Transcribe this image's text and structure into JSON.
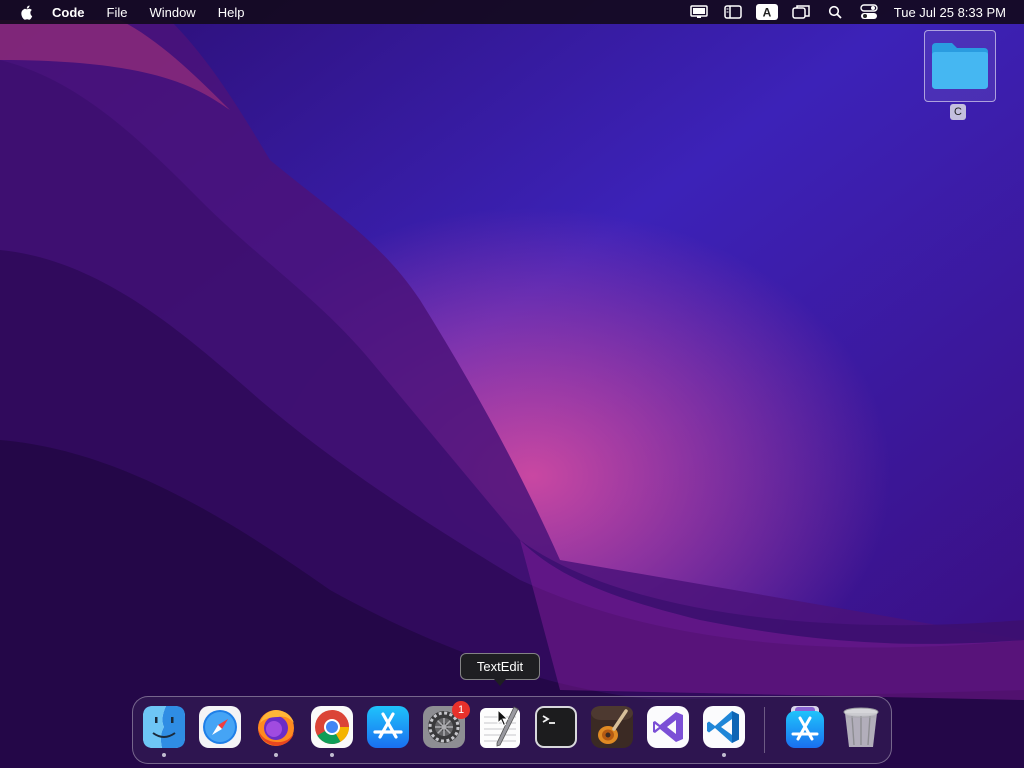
{
  "menubar": {
    "app_name": "Code",
    "items": [
      "File",
      "Window",
      "Help"
    ],
    "status_icons": [
      "display-icon",
      "sidebar-icon",
      "input-source-icon",
      "screen-mirroring-icon",
      "search-icon",
      "control-center-icon"
    ],
    "input_source_label": "A",
    "clock": "Tue Jul 25  8:33 PM"
  },
  "desktop": {
    "folder_label": "C"
  },
  "tooltip": {
    "text": "TextEdit"
  },
  "dock": {
    "apps": [
      {
        "name": "Finder",
        "icon": "finder-icon",
        "running": true
      },
      {
        "name": "Safari",
        "icon": "safari-icon",
        "running": false
      },
      {
        "name": "Firefox",
        "icon": "firefox-icon",
        "running": true
      },
      {
        "name": "Google Chrome",
        "icon": "chrome-icon",
        "running": true
      },
      {
        "name": "App Store",
        "icon": "app-store-icon",
        "running": false
      },
      {
        "name": "System Settings",
        "icon": "system-settings-icon",
        "running": false,
        "badge": "1"
      },
      {
        "name": "TextEdit",
        "icon": "textedit-icon",
        "running": false
      },
      {
        "name": "Terminal",
        "icon": "terminal-icon",
        "running": false
      },
      {
        "name": "GarageBand",
        "icon": "garageband-icon",
        "running": false
      },
      {
        "name": "Visual Studio",
        "icon": "visual-studio-icon",
        "running": false
      },
      {
        "name": "Visual Studio Code",
        "icon": "vscode-icon",
        "running": true
      }
    ],
    "extras": [
      {
        "name": "Downloads",
        "icon": "downloads-stack-icon"
      },
      {
        "name": "Trash",
        "icon": "trash-icon"
      }
    ]
  },
  "colors": {
    "wallpaper_top": "#3a1a9e",
    "wallpaper_pink": "#c02a6a",
    "wallpaper_bottom": "#1a0840",
    "badge": "#e8312b"
  }
}
